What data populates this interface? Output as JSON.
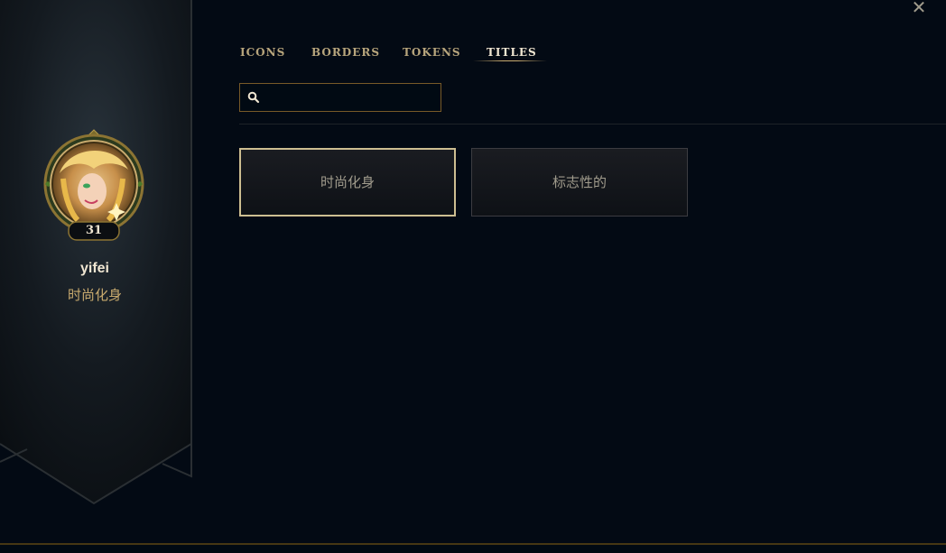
{
  "window": {
    "close_glyph": "✕"
  },
  "profile": {
    "username": "yifei",
    "title": "时尚化身",
    "level": "31"
  },
  "tabs": [
    {
      "label": "ICONS",
      "active": false
    },
    {
      "label": "BORDERS",
      "active": false
    },
    {
      "label": "TOKENS",
      "active": false
    },
    {
      "label": "TITLES",
      "active": true
    }
  ],
  "search": {
    "value": "",
    "placeholder": ""
  },
  "titles": [
    {
      "label": "时尚化身",
      "selected": true
    },
    {
      "label": "标志性的",
      "selected": false
    }
  ],
  "colors": {
    "gold": "#c8aa6e",
    "gold_light": "#f0e6d2",
    "background": "#030a14"
  }
}
